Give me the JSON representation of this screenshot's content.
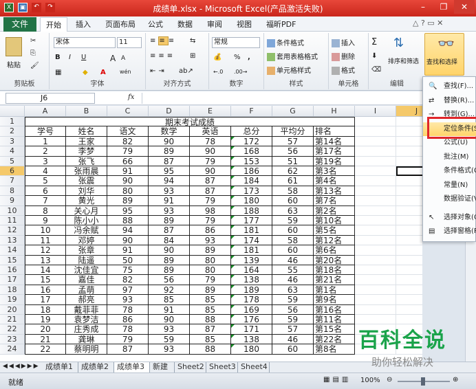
{
  "window": {
    "title": "成绩单.xlsx - Microsoft Excel(产品激活失败)"
  },
  "tabs": {
    "file": "文件",
    "items": [
      "开始",
      "插入",
      "页面布局",
      "公式",
      "数据",
      "审阅",
      "视图",
      "福昕PDF"
    ],
    "active": 0
  },
  "ribbon": {
    "clipboard": {
      "label": "剪贴板",
      "paste": "粘贴"
    },
    "font": {
      "label": "字体",
      "name": "宋体",
      "size": "11",
      "bold": "B",
      "italic": "I",
      "underline": "U",
      "grow": "A",
      "shrink": "A",
      "wen": "wén"
    },
    "align": {
      "label": "对齐方式"
    },
    "number": {
      "label": "数字",
      "format": "常规",
      "pct": "%",
      "comma": ","
    },
    "styles": {
      "label": "样式",
      "cond": "条件格式",
      "table": "套用表格格式",
      "cell": "单元格样式"
    },
    "cells": {
      "label": "单元格",
      "insert": "插入",
      "delete": "删除",
      "format": "格式"
    },
    "editing": {
      "label": "编辑",
      "sort": "排序和筛选",
      "find": "查找和选择",
      "sigma": "Σ"
    }
  },
  "formula_bar": {
    "name_box": "J6",
    "fx": "fx"
  },
  "columns": [
    "A",
    "B",
    "C",
    "D",
    "E",
    "F",
    "G",
    "H",
    "I",
    "J"
  ],
  "sheet": {
    "title": "期末考试成绩",
    "headers": [
      "学号",
      "姓名",
      "语文",
      "数学",
      "英语",
      "总分",
      "平均分",
      "排名"
    ],
    "rows": [
      [
        "1",
        "王家",
        "82",
        "90",
        "78",
        "172",
        "57",
        "第14名"
      ],
      [
        "2",
        "李梦",
        "79",
        "89",
        "90",
        "168",
        "56",
        "第17名"
      ],
      [
        "3",
        "张飞",
        "66",
        "87",
        "79",
        "153",
        "51",
        "第19名"
      ],
      [
        "4",
        "张雨晨",
        "91",
        "95",
        "90",
        "186",
        "62",
        "第3名"
      ],
      [
        "5",
        "张震",
        "90",
        "94",
        "87",
        "184",
        "61",
        "第4名"
      ],
      [
        "6",
        "刘华",
        "80",
        "93",
        "87",
        "173",
        "58",
        "第13名"
      ],
      [
        "7",
        "黄光",
        "89",
        "91",
        "79",
        "180",
        "60",
        "第7名"
      ],
      [
        "8",
        "关心月",
        "95",
        "93",
        "98",
        "188",
        "63",
        "第2名"
      ],
      [
        "9",
        "陈小小",
        "88",
        "89",
        "79",
        "177",
        "59",
        "第10名"
      ],
      [
        "10",
        "冯余赋",
        "94",
        "87",
        "86",
        "181",
        "60",
        "第5名"
      ],
      [
        "11",
        "邓婷",
        "90",
        "84",
        "93",
        "174",
        "58",
        "第12名"
      ],
      [
        "12",
        "张章",
        "91",
        "90",
        "89",
        "181",
        "60",
        "第6名"
      ],
      [
        "13",
        "陆遥",
        "50",
        "89",
        "80",
        "139",
        "46",
        "第20名"
      ],
      [
        "14",
        "沈佳宜",
        "75",
        "89",
        "80",
        "164",
        "55",
        "第18名"
      ],
      [
        "15",
        "嘉佳",
        "82",
        "56",
        "79",
        "138",
        "46",
        "第21名"
      ],
      [
        "16",
        "孟萌",
        "97",
        "92",
        "89",
        "189",
        "63",
        "第1名"
      ],
      [
        "17",
        "郝亮",
        "93",
        "85",
        "85",
        "178",
        "59",
        "第9名"
      ],
      [
        "18",
        "戴菲菲",
        "78",
        "91",
        "85",
        "169",
        "56",
        "第16名"
      ],
      [
        "19",
        "袁梦洁",
        "86",
        "90",
        "88",
        "176",
        "59",
        "第11名"
      ],
      [
        "20",
        "庄秀成",
        "78",
        "93",
        "87",
        "171",
        "57",
        "第15名"
      ],
      [
        "21",
        "龚琳",
        "79",
        "59",
        "85",
        "138",
        "46",
        "第22名"
      ],
      [
        "22",
        "蔡明明",
        "87",
        "93",
        "88",
        "180",
        "60",
        "第8名"
      ]
    ]
  },
  "menu": {
    "items": [
      "查找(F)...",
      "替换(R)...",
      "转到(G)...",
      "定位条件(S)...",
      "公式(U)",
      "批注(M)",
      "条件格式(C)",
      "常量(N)",
      "数据验证(V)",
      "选择对象(O)",
      "选择窗格(P)..."
    ]
  },
  "sheet_tabs": [
    "成绩单1",
    "成绩单2",
    "成绩单3",
    "新建",
    "Sheet2",
    "Sheet3",
    "Sheet4"
  ],
  "active_sheet": 2,
  "status": {
    "ready": "就绪",
    "zoom": "100%"
  },
  "watermark": {
    "big": "百科全说",
    "small": "助你轻松解决"
  }
}
